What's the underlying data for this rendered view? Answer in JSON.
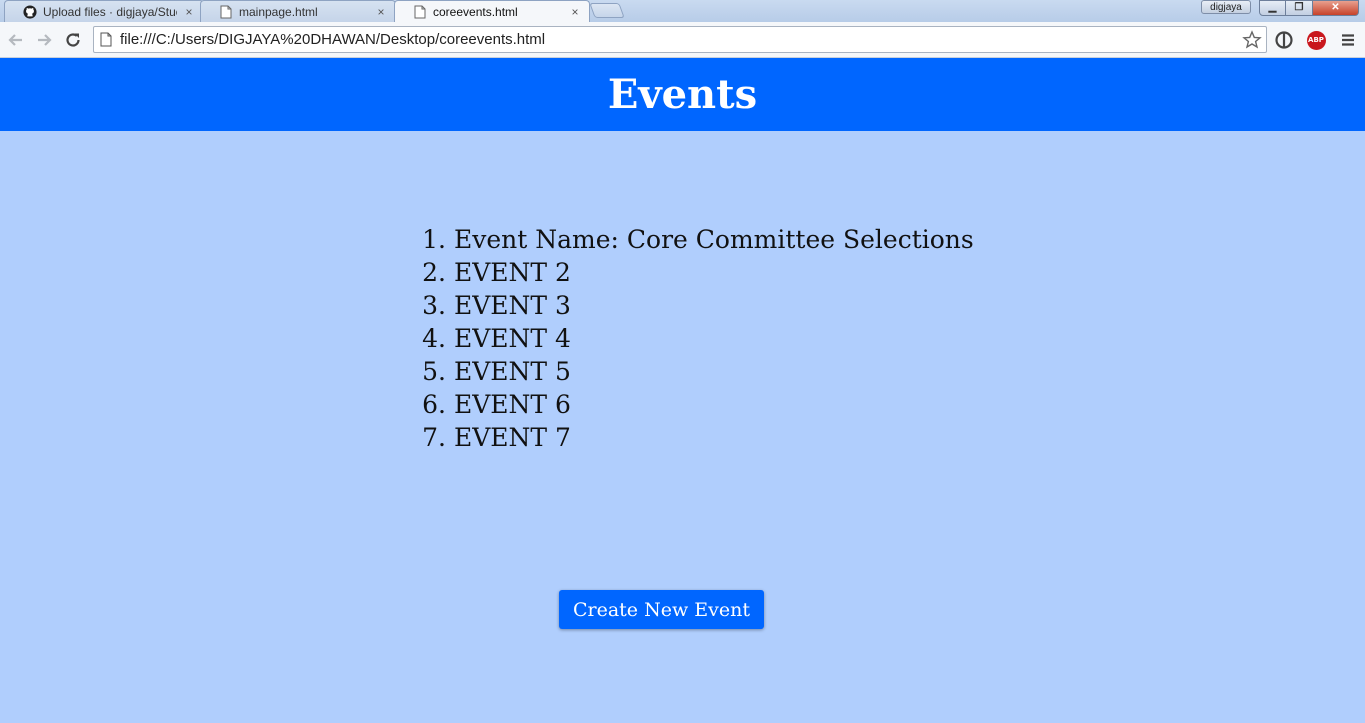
{
  "browser": {
    "tabs": [
      {
        "title": "Upload files · digjaya/Stuc",
        "icon": "github-icon",
        "active": false
      },
      {
        "title": "mainpage.html",
        "icon": "page-icon",
        "active": false
      },
      {
        "title": "coreevents.html",
        "icon": "page-icon",
        "active": true
      }
    ],
    "profile_name": "digjaya",
    "url": "file:///C:/Users/DIGJAYA%20DHAWAN/Desktop/coreevents.html",
    "tab_close_glyph": "×"
  },
  "page": {
    "title": "Events",
    "header_color": "#0066ff",
    "background_color": "#b0cefd",
    "events": [
      {
        "number": "1.",
        "name": "Event Name: Core Committee Selections"
      },
      {
        "number": "2.",
        "name": "EVENT 2"
      },
      {
        "number": "3.",
        "name": "EVENT 3"
      },
      {
        "number": "4.",
        "name": "EVENT 4"
      },
      {
        "number": "5.",
        "name": "EVENT 5"
      },
      {
        "number": "6.",
        "name": "EVENT 6"
      },
      {
        "number": "7.",
        "name": "EVENT 7"
      }
    ],
    "create_button_label": "Create New Event"
  }
}
